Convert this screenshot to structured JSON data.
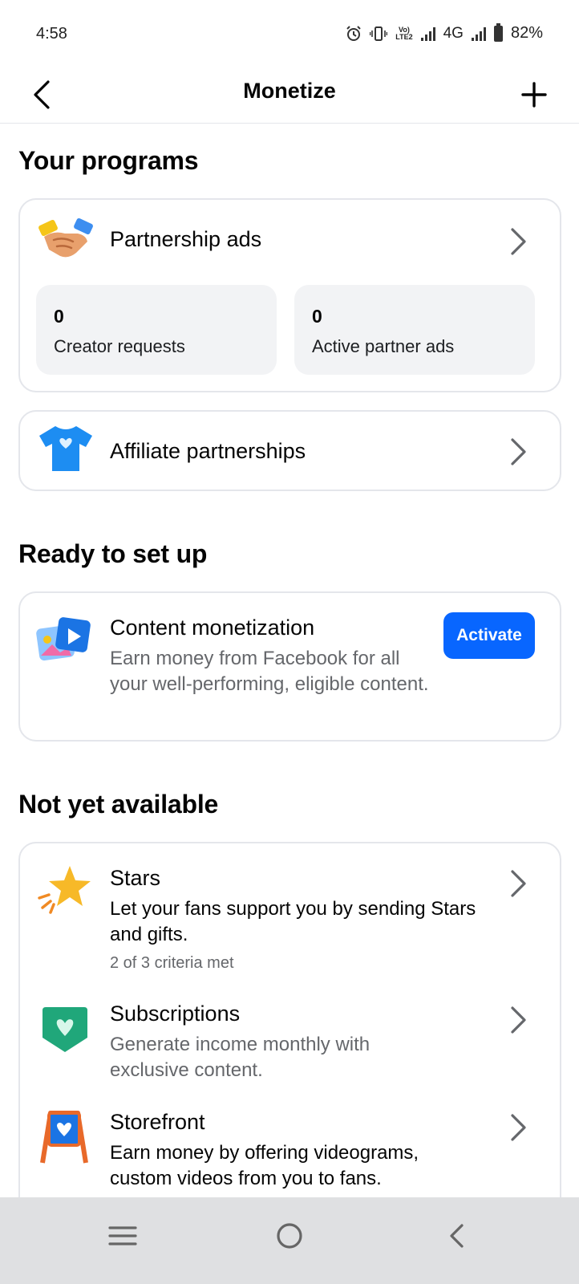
{
  "status_bar": {
    "time": "4:58",
    "network_label": "4G",
    "battery_percent": "82%"
  },
  "header": {
    "title": "Monetize"
  },
  "sections": {
    "your_programs": "Your programs",
    "ready_to_set_up": "Ready to set up",
    "not_yet_available": "Not yet available"
  },
  "partnership_ads": {
    "title": "Partnership ads",
    "icon": "handshake-icon",
    "stats": [
      {
        "value": "0",
        "label": "Creator requests"
      },
      {
        "value": "0",
        "label": "Active partner ads"
      }
    ]
  },
  "affiliate": {
    "title": "Affiliate partnerships",
    "icon": "tshirt-icon"
  },
  "content_monetization": {
    "title": "Content monetization",
    "description": "Earn money from Facebook for all your well-performing, eligible content.",
    "button_label": "Activate",
    "icon": "media-icon"
  },
  "not_available": [
    {
      "title": "Stars",
      "description": "Let your fans support you by sending Stars and gifts.",
      "meta": "2 of 3 criteria met",
      "icon": "star-icon"
    },
    {
      "title": "Subscriptions",
      "description": "Generate income monthly with exclusive content.",
      "icon": "heart-badge-icon"
    },
    {
      "title": "Storefront",
      "description": "Earn money by offering videograms, custom videos from you to fans.",
      "icon": "easel-icon"
    }
  ],
  "colors": {
    "accent": "#0866ff",
    "secondary_text": "#65676b",
    "card_border": "#e4e6eb",
    "stat_bg": "#f2f3f5",
    "nav_bg": "#dfe0e2"
  }
}
